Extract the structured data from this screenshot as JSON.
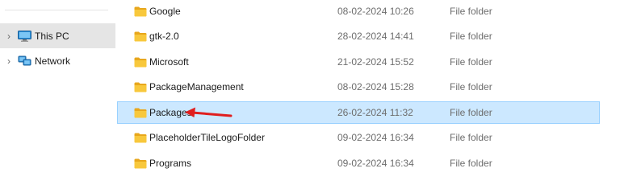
{
  "navigation": {
    "items": [
      {
        "label": "This PC",
        "icon": "computer-icon",
        "selected": true
      },
      {
        "label": "Network",
        "icon": "network-icon",
        "selected": false
      }
    ]
  },
  "files": [
    {
      "name": "Google",
      "date": "08-02-2024 10:26",
      "type": "File folder"
    },
    {
      "name": "gtk-2.0",
      "date": "28-02-2024 14:41",
      "type": "File folder"
    },
    {
      "name": "Microsoft",
      "date": "21-02-2024 15:52",
      "type": "File folder"
    },
    {
      "name": "PackageManagement",
      "date": "08-02-2024 15:28",
      "type": "File folder"
    },
    {
      "name": "Packages",
      "date": "26-02-2024 11:32",
      "type": "File folder",
      "selected": true
    },
    {
      "name": "PlaceholderTileLogoFolder",
      "date": "09-02-2024 16:34",
      "type": "File folder"
    },
    {
      "name": "Programs",
      "date": "09-02-2024 16:34",
      "type": "File folder"
    }
  ],
  "colors": {
    "selection_fill": "#cce8ff",
    "selection_border": "#99d1ff",
    "folder_yellow": "#f8c83c",
    "annotation_arrow": "#e01e1e"
  }
}
